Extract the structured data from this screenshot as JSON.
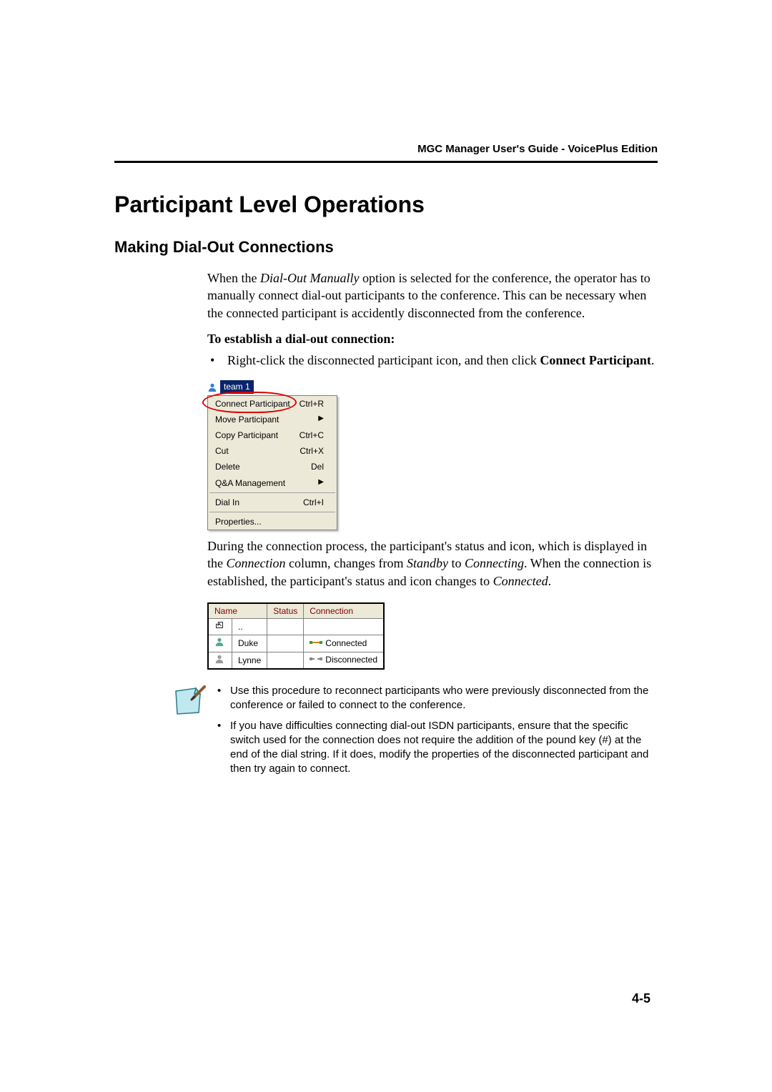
{
  "header": {
    "running": "MGC Manager User's Guide - VoicePlus Edition"
  },
  "title": "Participant Level Operations",
  "section": "Making Dial-Out Connections",
  "intro": {
    "pre": "When the ",
    "em": "Dial-Out Manually",
    "post": " option is selected for the conference, the operator has to manually connect dial-out participants to the conference. This can be necessary when the connected participant is accidently disconnected from the conference."
  },
  "subhead": "To establish a dial-out connection:",
  "step1": {
    "pre": "Right-click the disconnected participant icon, and then click ",
    "bold1": "Connect Participant",
    "post": "."
  },
  "ctx": {
    "tree_label": "team 1",
    "items": [
      {
        "label": "Connect Participant",
        "accel": "Ctrl+R",
        "sub": false
      },
      {
        "label": "Move Participant",
        "accel": "",
        "sub": true
      },
      {
        "label": "Copy Participant",
        "accel": "Ctrl+C",
        "sub": false
      },
      {
        "label": "Cut",
        "accel": "Ctrl+X",
        "sub": false
      },
      {
        "label": "Delete",
        "accel": "Del",
        "sub": false
      },
      {
        "label": "Q&A Management",
        "accel": "",
        "sub": true
      },
      {
        "label": "Dial In",
        "accel": "Ctrl+I",
        "sub": false
      },
      {
        "label": "Properties...",
        "accel": "",
        "sub": false
      }
    ]
  },
  "para2": {
    "t1": "During the connection process, the participant's status and icon, which is displayed in the ",
    "i1": "Connection",
    "t2": " column, changes from ",
    "i2": "Standby",
    "t3": " to ",
    "i3": "Connecting",
    "t4": ". When the connection is established, the participant's status and icon changes to ",
    "i4": "Connected",
    "t5": "."
  },
  "status": {
    "headers": [
      "Name",
      "Status",
      "Connection"
    ],
    "rows": [
      {
        "name": "..",
        "status": "",
        "connection": ""
      },
      {
        "name": "Duke",
        "status": "",
        "connection": "Connected"
      },
      {
        "name": "Lynne",
        "status": "",
        "connection": "Disconnected"
      }
    ]
  },
  "notes": [
    "Use this procedure to reconnect participants who were previously disconnected from the conference or failed to connect to the conference.",
    "If you have difficulties connecting dial-out ISDN participants, ensure that the specific switch used for the connection does not require the addition of the pound key (#) at the end of the dial string. If it does, modify the properties of the disconnected participant and then try again to connect."
  ],
  "page_number": "4-5"
}
